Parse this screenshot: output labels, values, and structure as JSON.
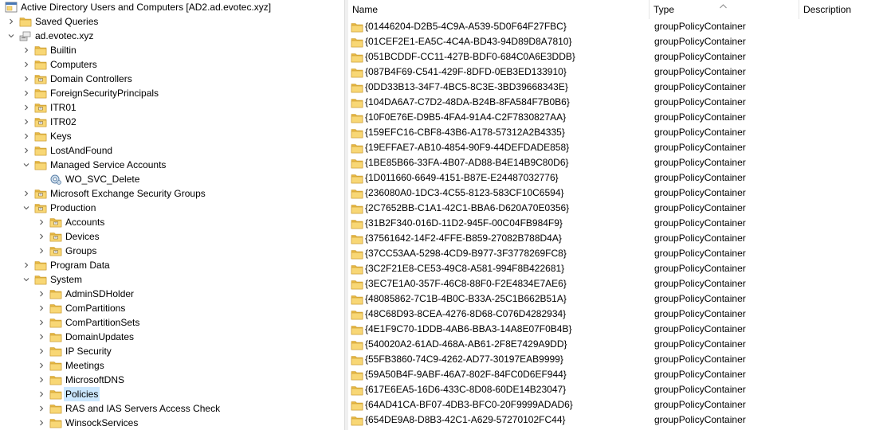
{
  "tree": {
    "root": "Active Directory Users and Computers [AD2.ad.evotec.xyz]",
    "nodes": [
      {
        "label": "Saved Queries",
        "depth": 1,
        "icon": "saved-queries-folder-icon",
        "chevron": "right"
      },
      {
        "label": "ad.evotec.xyz",
        "depth": 1,
        "icon": "domain-icon",
        "chevron": "down"
      },
      {
        "label": "Builtin",
        "depth": 2,
        "icon": "folder-icon",
        "chevron": "right"
      },
      {
        "label": "Computers",
        "depth": 2,
        "icon": "folder-icon",
        "chevron": "right"
      },
      {
        "label": "Domain Controllers",
        "depth": 2,
        "icon": "ou-folder-icon",
        "chevron": "right"
      },
      {
        "label": "ForeignSecurityPrincipals",
        "depth": 2,
        "icon": "folder-icon",
        "chevron": "right"
      },
      {
        "label": "ITR01",
        "depth": 2,
        "icon": "ou-folder-icon",
        "chevron": "right"
      },
      {
        "label": "ITR02",
        "depth": 2,
        "icon": "ou-folder-icon",
        "chevron": "right"
      },
      {
        "label": "Keys",
        "depth": 2,
        "icon": "folder-icon",
        "chevron": "right"
      },
      {
        "label": "LostAndFound",
        "depth": 2,
        "icon": "folder-icon",
        "chevron": "right"
      },
      {
        "label": "Managed Service Accounts",
        "depth": 2,
        "icon": "folder-icon",
        "chevron": "down"
      },
      {
        "label": "WO_SVC_Delete",
        "depth": 3,
        "icon": "service-account-icon",
        "chevron": "none"
      },
      {
        "label": "Microsoft Exchange Security Groups",
        "depth": 2,
        "icon": "ou-folder-icon",
        "chevron": "right"
      },
      {
        "label": "Production",
        "depth": 2,
        "icon": "ou-folder-icon",
        "chevron": "down"
      },
      {
        "label": "Accounts",
        "depth": 3,
        "icon": "ou-folder-icon",
        "chevron": "right"
      },
      {
        "label": "Devices",
        "depth": 3,
        "icon": "ou-folder-icon",
        "chevron": "right"
      },
      {
        "label": "Groups",
        "depth": 3,
        "icon": "ou-folder-icon",
        "chevron": "right"
      },
      {
        "label": "Program Data",
        "depth": 2,
        "icon": "folder-icon",
        "chevron": "right"
      },
      {
        "label": "System",
        "depth": 2,
        "icon": "folder-icon",
        "chevron": "down"
      },
      {
        "label": "AdminSDHolder",
        "depth": 3,
        "icon": "folder-icon",
        "chevron": "right"
      },
      {
        "label": "ComPartitions",
        "depth": 3,
        "icon": "folder-icon",
        "chevron": "right"
      },
      {
        "label": "ComPartitionSets",
        "depth": 3,
        "icon": "folder-icon",
        "chevron": "right"
      },
      {
        "label": "DomainUpdates",
        "depth": 3,
        "icon": "folder-icon",
        "chevron": "right"
      },
      {
        "label": "IP Security",
        "depth": 3,
        "icon": "folder-icon",
        "chevron": "right"
      },
      {
        "label": "Meetings",
        "depth": 3,
        "icon": "folder-icon",
        "chevron": "right"
      },
      {
        "label": "MicrosoftDNS",
        "depth": 3,
        "icon": "folder-icon",
        "chevron": "right"
      },
      {
        "label": "Policies",
        "depth": 3,
        "icon": "folder-icon",
        "chevron": "right",
        "selected": true
      },
      {
        "label": "RAS and IAS Servers Access Check",
        "depth": 3,
        "icon": "folder-icon",
        "chevron": "right"
      },
      {
        "label": "WinsockServices",
        "depth": 3,
        "icon": "folder-icon",
        "chevron": "right"
      }
    ]
  },
  "list": {
    "columns": [
      "Name",
      "Type",
      "Description"
    ],
    "rows": [
      {
        "name": "{01446204-D2B5-4C9A-A539-5D0F64F27FBC}",
        "type": "groupPolicyContainer"
      },
      {
        "name": "{01CEF2E1-EA5C-4C4A-BD43-94D89D8A7810}",
        "type": "groupPolicyContainer"
      },
      {
        "name": "{051BCDDF-CC11-427B-BDF0-684C0A6E3DDB}",
        "type": "groupPolicyContainer"
      },
      {
        "name": "{087B4F69-C541-429F-8DFD-0EB3ED133910}",
        "type": "groupPolicyContainer"
      },
      {
        "name": "{0DD33B13-34F7-4BC5-8C3E-3BD39668343E}",
        "type": "groupPolicyContainer"
      },
      {
        "name": "{104DA6A7-C7D2-48DA-B24B-8FA584F7B0B6}",
        "type": "groupPolicyContainer"
      },
      {
        "name": "{10F0E76E-D9B5-4FA4-91A4-C2F7830827AA}",
        "type": "groupPolicyContainer"
      },
      {
        "name": "{159EFC16-CBF8-43B6-A178-57312A2B4335}",
        "type": "groupPolicyContainer"
      },
      {
        "name": "{19EFFAE7-AB10-4854-90F9-44DEFDADE858}",
        "type": "groupPolicyContainer"
      },
      {
        "name": "{1BE85B66-33FA-4B07-AD88-B4E14B9C80D6}",
        "type": "groupPolicyContainer"
      },
      {
        "name": "{1D011660-6649-4151-B87E-E24487032776}",
        "type": "groupPolicyContainer"
      },
      {
        "name": "{236080A0-1DC3-4C55-8123-583CF10C6594}",
        "type": "groupPolicyContainer"
      },
      {
        "name": "{2C7652BB-C1A1-42C1-BBA6-D620A70E0356}",
        "type": "groupPolicyContainer"
      },
      {
        "name": "{31B2F340-016D-11D2-945F-00C04FB984F9}",
        "type": "groupPolicyContainer"
      },
      {
        "name": "{37561642-14F2-4FFE-B859-27082B788D4A}",
        "type": "groupPolicyContainer"
      },
      {
        "name": "{37CC53AA-5298-4CD9-B977-3F3778269FC8}",
        "type": "groupPolicyContainer"
      },
      {
        "name": "{3C2F21E8-CE53-49C8-A581-994F8B422681}",
        "type": "groupPolicyContainer"
      },
      {
        "name": "{3EC7E1A0-357F-46C8-88F0-F2E4834E7AE6}",
        "type": "groupPolicyContainer"
      },
      {
        "name": "{48085862-7C1B-4B0C-B33A-25C1B662B51A}",
        "type": "groupPolicyContainer"
      },
      {
        "name": "{48C68D93-8CEA-4276-8D68-C076D4282934}",
        "type": "groupPolicyContainer"
      },
      {
        "name": "{4E1F9C70-1DDB-4AB6-BBA3-14A8E07F0B4B}",
        "type": "groupPolicyContainer"
      },
      {
        "name": "{540020A2-61AD-468A-AB61-2F8E7429A9DD}",
        "type": "groupPolicyContainer"
      },
      {
        "name": "{55FB3860-74C9-4262-AD77-30197EAB9999}",
        "type": "groupPolicyContainer"
      },
      {
        "name": "{59A50B4F-9ABF-46A7-802F-84FC0D6EF944}",
        "type": "groupPolicyContainer"
      },
      {
        "name": "{617E6EA5-16D6-433C-8D08-60DE14B23047}",
        "type": "groupPolicyContainer"
      },
      {
        "name": "{64AD41CA-BF07-4DB3-BFC0-20F9999ADAD6}",
        "type": "groupPolicyContainer"
      },
      {
        "name": "{654DE9A8-D8B3-42C1-A629-57270102FC44}",
        "type": "groupPolicyContainer"
      }
    ]
  },
  "colors": {
    "selection": "#cce8ff",
    "folder_body": "#f8d775",
    "folder_back": "#e7b843",
    "chevron": "#5a5a5a"
  }
}
